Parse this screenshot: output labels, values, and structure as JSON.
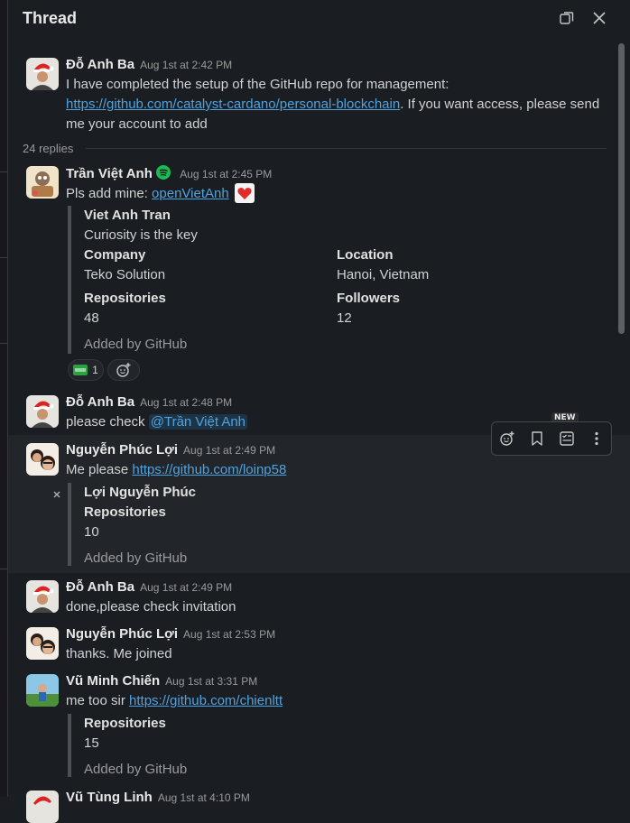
{
  "thread": {
    "title": "Thread",
    "replies_count": "24 replies"
  },
  "colors": {
    "background": "#1a1d21",
    "hover_row": "#222529",
    "link": "#4fa3e0",
    "spotify_green": "#1db954"
  },
  "messages": [
    {
      "author": "Đỗ Anh Ba",
      "time": "Aug 1st at 2:42 PM",
      "text_1": "I have completed the setup of the GitHub repo for management:",
      "link": "https://github.com/catalyst-cardano/personal-blockchain",
      "text_2": ". If you want access, please send",
      "text_3": "me your account to add"
    },
    {
      "author": "Trần Việt Anh",
      "status_icon": "spotify-icon",
      "time": "Aug 1st at 2:45 PM",
      "text": "Pls add mine: ",
      "link": "openVietAnh",
      "attachment": {
        "name": "Viet Anh Tran",
        "bio": "Curiosity is the key",
        "company_label": "Company",
        "company": "Teko Solution",
        "location_label": "Location",
        "location": "Hanoi, Vietnam",
        "repos_label": "Repositories",
        "repos": "48",
        "followers_label": "Followers",
        "followers": "12",
        "added_by": "Added by GitHub"
      },
      "reaction_count": "1"
    },
    {
      "author": "Đỗ Anh Ba",
      "time": "Aug 1st at 2:48 PM",
      "text": "please check ",
      "mention": "@Trần Việt Anh"
    },
    {
      "author": "Nguyễn Phúc Lợi",
      "time": "Aug 1st at 2:49 PM",
      "text": "Me please ",
      "link": "https://github.com/loinp58",
      "attachment": {
        "name": "Lợi Nguyễn Phúc",
        "repos_label": "Repositories",
        "repos": "10",
        "added_by": "Added by GitHub"
      }
    },
    {
      "author": "Đỗ Anh Ba",
      "time": "Aug 1st at 2:49 PM",
      "text": "done,please check invitation"
    },
    {
      "author": "Nguyễn Phúc Lợi",
      "time": "Aug 1st at 2:53 PM",
      "text": "thanks. Me joined"
    },
    {
      "author": "Vũ Minh Chiến",
      "time": "Aug 1st at 3:31 PM",
      "text": "me too sir ",
      "link": "https://github.com/chienltt",
      "attachment": {
        "repos_label": "Repositories",
        "repos": "15",
        "added_by": "Added by GitHub"
      }
    },
    {
      "author": "Vũ Tùng Linh",
      "time": "Aug 1st at 4:10 PM"
    }
  ],
  "toolbar": {
    "new_badge": "NEW",
    "icons": [
      "add-reaction-icon",
      "bookmark-icon",
      "task-list-icon",
      "more-actions-icon"
    ]
  },
  "header_icons": [
    "open-in-window-icon",
    "close-icon"
  ]
}
